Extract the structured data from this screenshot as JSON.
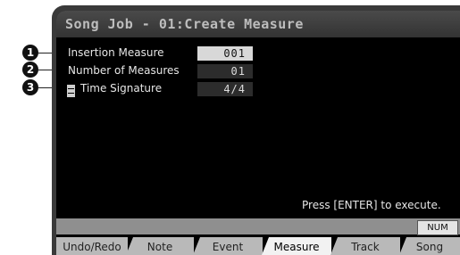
{
  "window": {
    "title": "Song Job - 01:Create Measure"
  },
  "params": [
    {
      "label": "Insertion Measure",
      "value": "001",
      "callout": "1"
    },
    {
      "label": "Number of Measures",
      "value": "01",
      "callout": "2"
    },
    {
      "label": "Time Signature",
      "value": "4/4",
      "callout": "3"
    }
  ],
  "hint": "Press [ENTER] to execute.",
  "num_button": "NUM",
  "tabs": [
    {
      "label": "Undo/Redo"
    },
    {
      "label": "Note"
    },
    {
      "label": "Event"
    },
    {
      "label": "Measure"
    },
    {
      "label": "Track"
    },
    {
      "label": "Song"
    }
  ],
  "active_tab": "Measure"
}
